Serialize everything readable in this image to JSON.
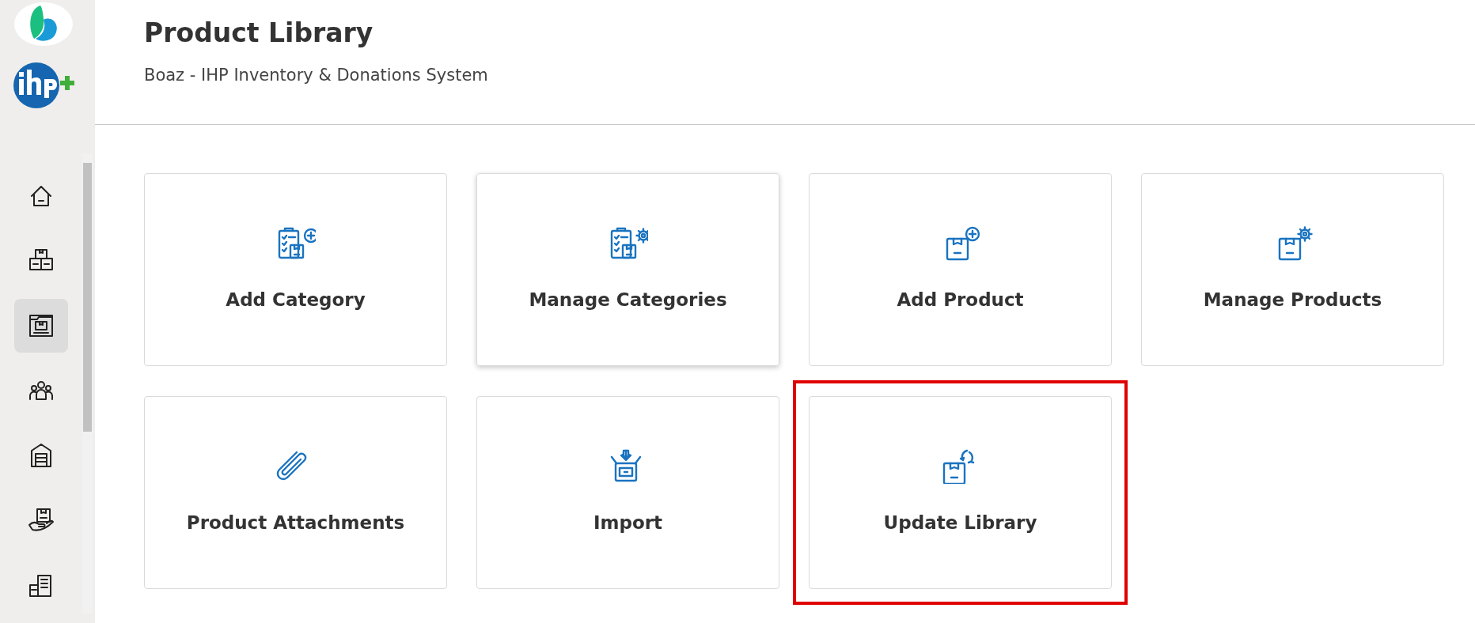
{
  "header": {
    "title": "Product Library",
    "subtitle": "Boaz - IHP Inventory & Donations System"
  },
  "sidebar": {
    "items": [
      {
        "selected": false
      },
      {
        "selected": false
      },
      {
        "selected": true
      },
      {
        "selected": false
      },
      {
        "selected": false
      },
      {
        "selected": false
      },
      {
        "selected": false
      }
    ]
  },
  "cards": [
    {
      "label": "Add Category",
      "hovered": false,
      "highlighted": false
    },
    {
      "label": "Manage Categories",
      "hovered": true,
      "highlighted": false
    },
    {
      "label": "Add Product",
      "hovered": false,
      "highlighted": false
    },
    {
      "label": "Manage Products",
      "hovered": false,
      "highlighted": false
    },
    {
      "label": "Product Attachments",
      "hovered": false,
      "highlighted": false
    },
    {
      "label": "Import",
      "hovered": false,
      "highlighted": false
    },
    {
      "label": "Update Library",
      "hovered": false,
      "highlighted": true
    }
  ]
}
